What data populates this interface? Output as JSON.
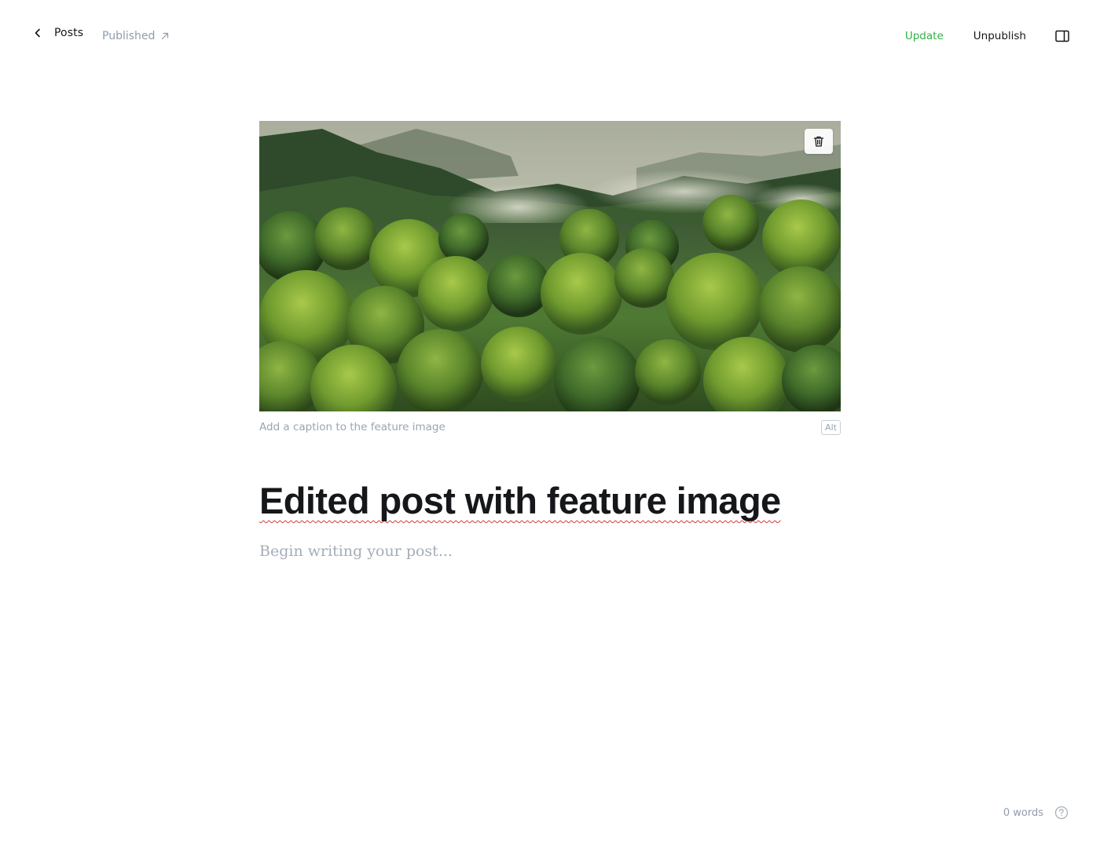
{
  "topbar": {
    "back_label": "Posts",
    "status_label": "Published",
    "update_label": "Update",
    "unpublish_label": "Unpublish",
    "update_color": "#2fb344"
  },
  "feature_image": {
    "caption_placeholder": "Add a caption to the feature image",
    "alt_label": "Alt"
  },
  "post": {
    "title": "Edited post with feature image",
    "body_placeholder": "Begin writing your post..."
  },
  "footer": {
    "word_count": "0 words"
  },
  "icons": {
    "back": "chevron-left-icon",
    "status": "arrow-up-right-icon",
    "sidebar": "sidebar-toggle-icon",
    "delete": "trash-icon",
    "help": "question-circle-icon"
  }
}
